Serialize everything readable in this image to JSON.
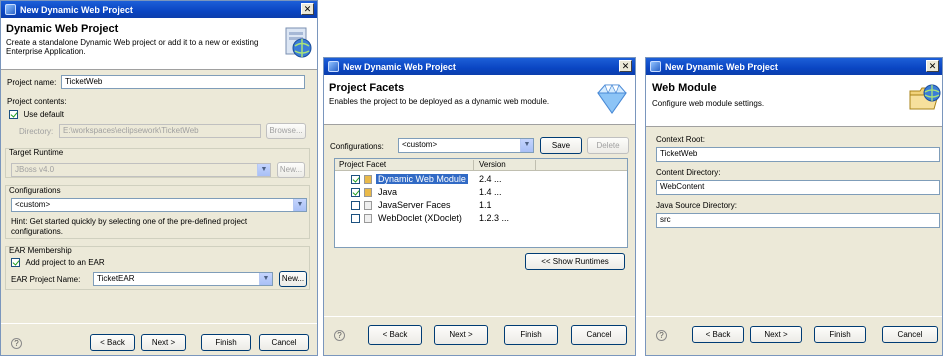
{
  "window1": {
    "title": "New Dynamic Web Project",
    "banner_title": "Dynamic Web Project",
    "banner_desc_line1": "Create a standalone Dynamic Web project or add it to a new or existing",
    "banner_desc_line2": "Enterprise Application.",
    "project_name_label": "Project name:",
    "project_name_value": "TicketWeb",
    "contents_label": "Project contents:",
    "use_default_label": "Use default",
    "directory_label": "Directory:",
    "directory_value": "E:\\workspaces\\eclipsework\\TicketWeb",
    "browse_label": "Browse...",
    "runtime_label": "Target Runtime",
    "runtime_value": "JBoss v4.0",
    "runtime_new_label": "New...",
    "config_label": "Configurations",
    "config_value": "<custom>",
    "hint_line1": "Hint: Get started quickly by selecting one of the pre-defined project",
    "hint_line2": "configurations.",
    "ear_label": "EAR Membership",
    "add_ear_label": "Add project to an EAR",
    "ear_name_label": "EAR Project Name:",
    "ear_name_value": "TicketEAR",
    "ear_new_label": "New...",
    "back_label": "< Back",
    "next_label": "Next >",
    "finish_label": "Finish",
    "cancel_label": "Cancel"
  },
  "window2": {
    "title": "New Dynamic Web Project",
    "banner_title": "Project Facets",
    "banner_desc": "Enables the project to be deployed as a dynamic web module.",
    "config_label": "Configurations:",
    "config_value": "<custom>",
    "save_label": "Save",
    "delete_label": "Delete",
    "col_facet": "Project Facet",
    "col_version": "Version",
    "facets": [
      {
        "name": "Dynamic Web Module",
        "version": "2.4 ...",
        "checked": true,
        "selected": true
      },
      {
        "name": "Java",
        "version": "1.4 ...",
        "checked": true,
        "selected": false
      },
      {
        "name": "JavaServer Faces",
        "version": "1.1",
        "checked": false,
        "selected": false
      },
      {
        "name": "WebDoclet (XDoclet)",
        "version": "1.2.3 ...",
        "checked": false,
        "selected": false
      }
    ],
    "show_runtimes_label": "<< Show Runtimes",
    "back_label": "< Back",
    "next_label": "Next >",
    "finish_label": "Finish",
    "cancel_label": "Cancel"
  },
  "window3": {
    "title": "New Dynamic Web Project",
    "banner_title": "Web Module",
    "banner_desc": "Configure web module settings.",
    "context_root_label": "Context Root:",
    "context_root_value": "TicketWeb",
    "content_dir_label": "Content Directory:",
    "content_dir_value": "WebContent",
    "java_src_label": "Java Source Directory:",
    "java_src_value": "src",
    "back_label": "< Back",
    "next_label": "Next >",
    "finish_label": "Finish",
    "cancel_label": "Cancel"
  },
  "icons": {
    "app": "eclipse-app-icon",
    "wizard1": "web-project-icon",
    "wizard2": "diamond-facet-icon",
    "wizard3": "folder-globe-icon",
    "help": "help-icon",
    "close": "close-icon"
  },
  "colors": {
    "titlebar": "#0a45c2",
    "dialog_bg": "#ece9d8",
    "selection": "#316ac5"
  }
}
